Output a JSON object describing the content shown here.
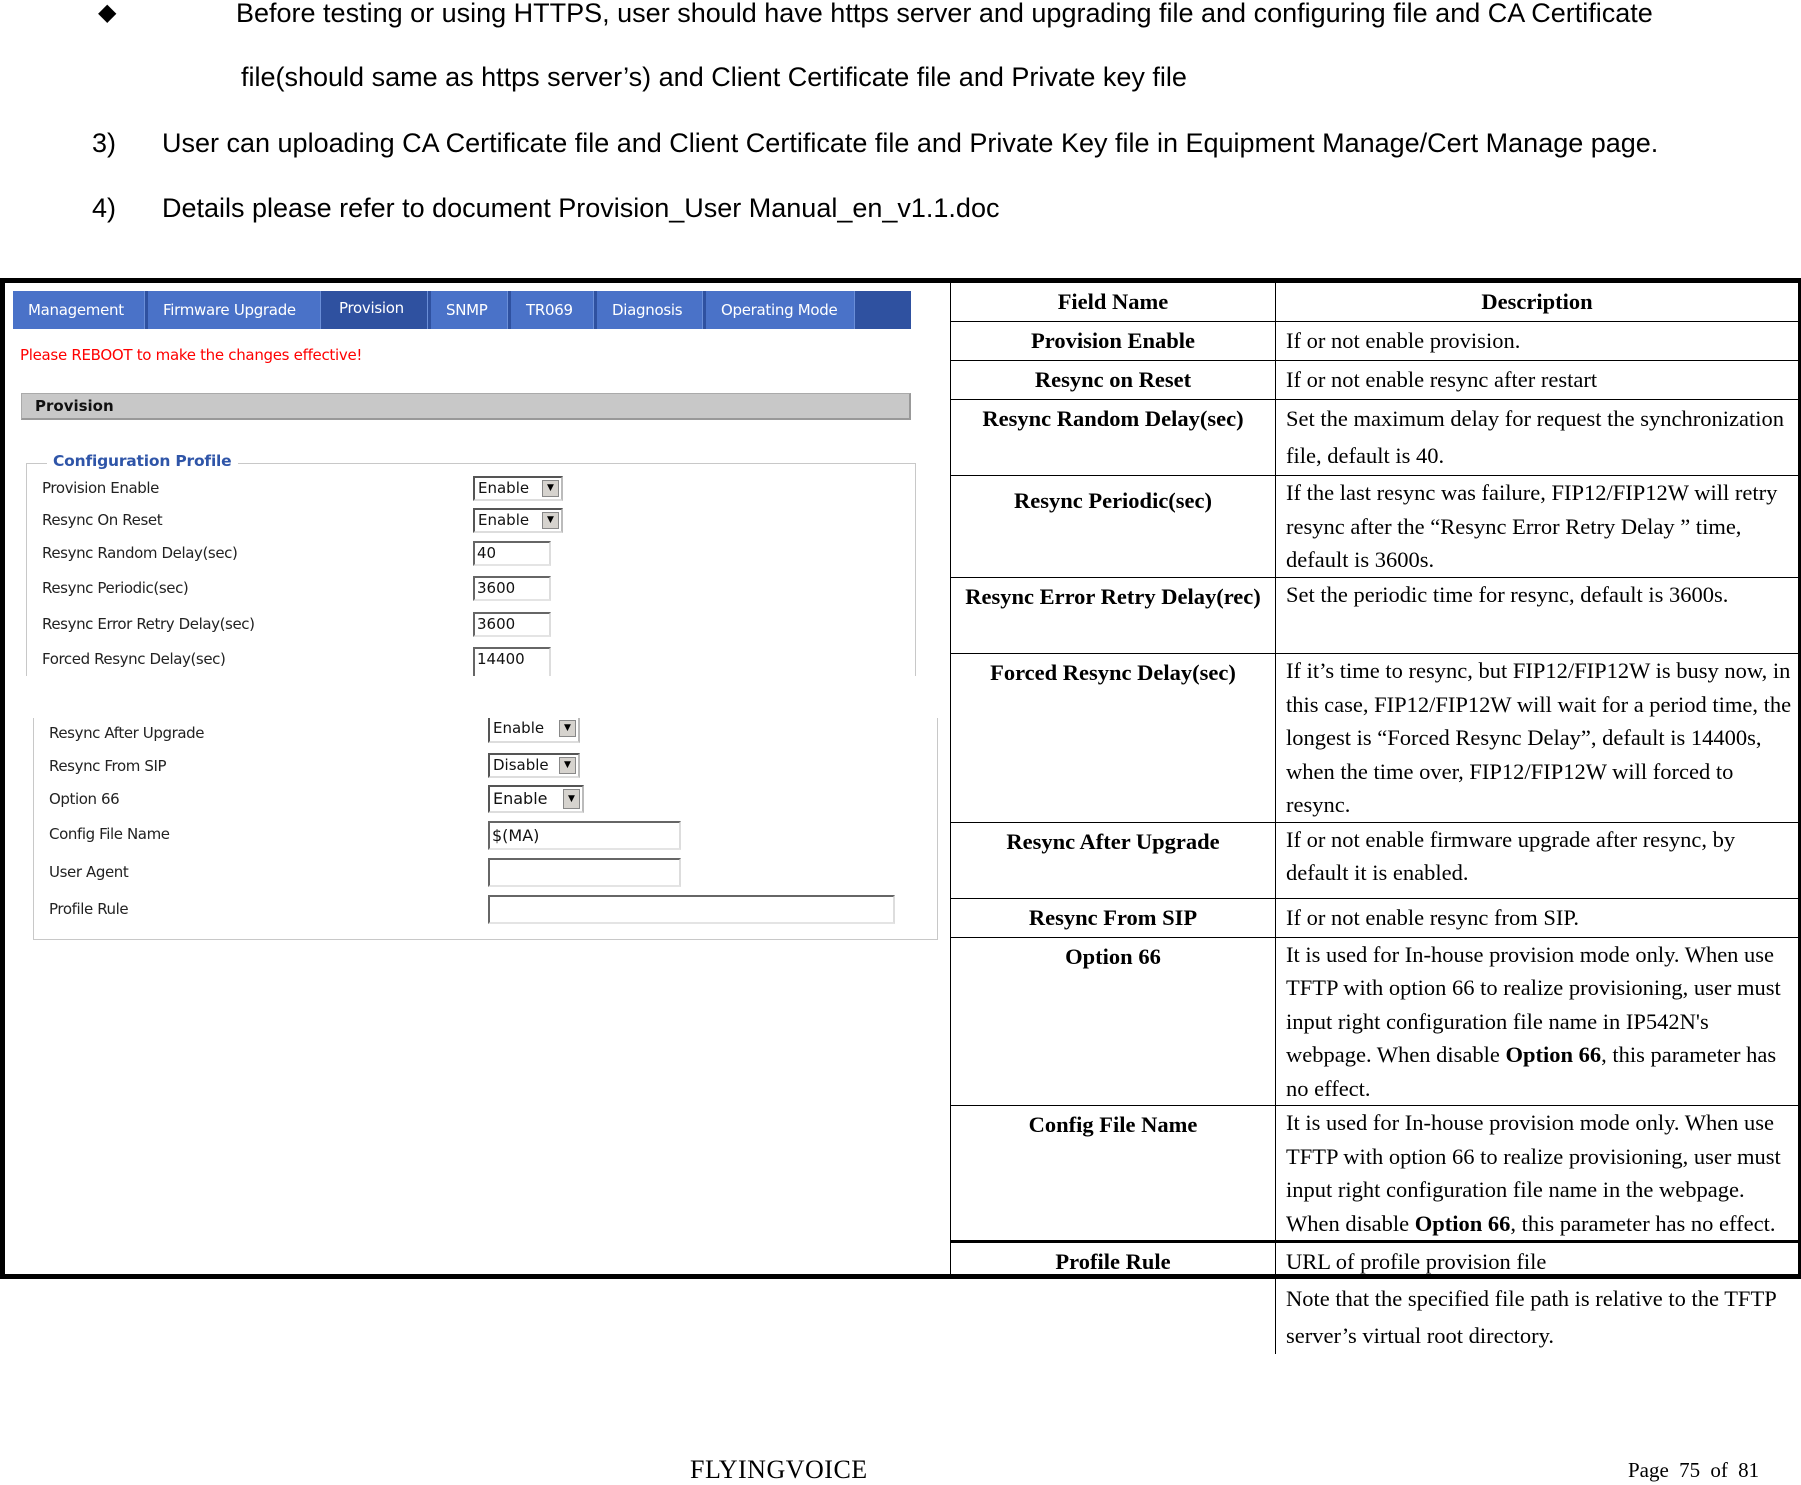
{
  "intro": {
    "bullet_icon": "diamond-bullet",
    "bullet_line1": "Before testing or using HTTPS, user should have https server and upgrading file and configuring file and CA Certificate",
    "bullet_line2": "file(should same as https server’s) and Client Certificate file and Private key file",
    "items": [
      {
        "number": "3)",
        "text": "User can uploading CA Certificate file and Client Certificate file and Private Key file in Equipment Manage/Cert Manage page."
      },
      {
        "number": "4)",
        "text": "Details please refer to document Provision_User Manual_en_v1.1.doc"
      }
    ]
  },
  "screenshot": {
    "tabs": [
      {
        "label": "Management",
        "active": false
      },
      {
        "label": "Firmware Upgrade",
        "active": false
      },
      {
        "label": "Provision",
        "active": true
      },
      {
        "label": "SNMP",
        "active": false
      },
      {
        "label": "TR069",
        "active": false
      },
      {
        "label": "Diagnosis",
        "active": false
      },
      {
        "label": "Operating Mode",
        "active": false
      }
    ],
    "reboot_notice": "Please REBOOT to make the changes effective!",
    "section_title": "Provision",
    "fieldset_legend": "Configuration Profile",
    "fields_part1": [
      {
        "label": "Provision Enable",
        "type": "select",
        "value": "Enable"
      },
      {
        "label": "Resync On Reset",
        "type": "select",
        "value": "Enable"
      },
      {
        "label": "Resync Random Delay(sec)",
        "type": "text",
        "value": "40"
      },
      {
        "label": "Resync Periodic(sec)",
        "type": "text",
        "value": "3600"
      },
      {
        "label": "Resync Error Retry Delay(sec)",
        "type": "text",
        "value": "3600"
      },
      {
        "label": "Forced Resync Delay(sec)",
        "type": "text",
        "value": "14400"
      }
    ],
    "fields_part2": [
      {
        "label": "Resync After Upgrade",
        "type": "select",
        "value": "Enable"
      },
      {
        "label": "Resync From SIP",
        "type": "select",
        "value": "Disable"
      },
      {
        "label": "Option 66",
        "type": "select",
        "value": "Enable"
      },
      {
        "label": "Config File Name",
        "type": "text",
        "value": "$(MA)"
      },
      {
        "label": "User Agent",
        "type": "text",
        "value": ""
      },
      {
        "label": "Profile Rule",
        "type": "text",
        "value": ""
      }
    ],
    "colors": {
      "tab_bar": "#2f51a0",
      "tab": "#4a72c8",
      "notice": "#ff0000",
      "legend": "#2f55a8"
    }
  },
  "table": {
    "headers": [
      "Field Name",
      "Description"
    ],
    "rows": [
      {
        "field": "Provision Enable",
        "description": "If or not enable provision."
      },
      {
        "field": "Resync on Reset",
        "description": "If or not enable resync after restart"
      },
      {
        "field": "Resync Random Delay(sec)",
        "description": "Set the maximum delay for request the synchronization file, default is 40."
      },
      {
        "field": "Resync Periodic(sec)",
        "description": "If the last resync was failure, FIP12/FIP12W will retry resync after the “Resync Error Retry Delay ” time, default is 3600s."
      },
      {
        "field": "Resync Error Retry Delay(rec)",
        "description": "Set the periodic time for resync, default is 3600s."
      },
      {
        "field": "Forced Resync Delay(sec)",
        "description": "If it’s time to resync, but FIP12/FIP12W is busy now, in this case, FIP12/FIP12W will wait for a period time, the longest is “Forced Resync Delay”, default is 14400s, when the time over, FIP12/FIP12W will forced to resync."
      },
      {
        "field": "Resync After Upgrade",
        "description": "If or not enable firmware upgrade after resync, by default it is enabled."
      },
      {
        "field": "Resync From SIP",
        "description": "If or not enable resync from SIP."
      },
      {
        "field": "Option 66",
        "description_pre": "It is used for In-house provision mode only. When use TFTP with option 66 to realize provisioning, user must input right configuration file name in IP542N's webpage. When disable ",
        "description_bold": "Option 66",
        "description_post": ", this parameter has no effect."
      },
      {
        "field": "Config File Name",
        "description_pre": "It is used for In-house provision mode only. When use TFTP with option 66 to realize provisioning, user must input right configuration file name in the webpage. When disable ",
        "description_bold": "Option 66",
        "description_post": ", this parameter has no effect."
      },
      {
        "field": "Profile Rule",
        "description_line1": "URL of profile provision file",
        "description_line2": "Note that the specified file path is relative to the TFTP server’s virtual root directory."
      }
    ]
  },
  "footer": {
    "brand": "FLYINGVOICE",
    "page_label": "Page",
    "page_current": "75",
    "page_of": "of",
    "page_total": "81"
  }
}
